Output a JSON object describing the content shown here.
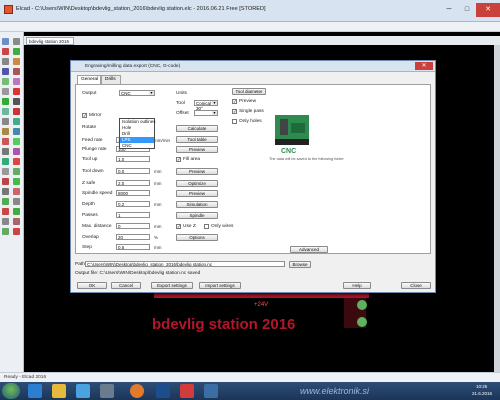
{
  "window": {
    "title": "Elcad - C:\\Users\\WIN\\Desktop\\bdevlig_station_2016\\bdevlig station.elc - 2016.06.21 Free [STORED]",
    "minimize": "─",
    "maximize": "□",
    "close": "✕"
  },
  "tab": {
    "label": "bdevlig station 2016"
  },
  "dialog": {
    "title": "Engraving/milling data export (CNC, G-code)",
    "close": "✕",
    "tabs": [
      "General",
      "Drills"
    ],
    "fields": {
      "output_label": "Output",
      "output_value": "CNC",
      "output_options": [
        "Isolation outlines",
        "Hole",
        "Drill",
        "LPS",
        "CNC"
      ],
      "units_label": "Units",
      "mirror_label": "Mirror",
      "rotate_label": "Rotate",
      "tool_label": "Tool",
      "tool_value": "Conical 30°",
      "offset_label": "Offset",
      "set_origin_label": "Set origin",
      "feedrate_label": "Feed rate",
      "feedrate_value": "100",
      "feedrate_unit": "mm/min",
      "plunge_label": "Plunge rate",
      "plunge_value": "100",
      "tool_up_label": "Tool up",
      "tool_up_value": "1.0",
      "tool_down_label": "Tool down",
      "tool_down_value": "0.0",
      "z_safe_label": "Z safe",
      "z_safe_value": "2.0",
      "speed_label": "Spindle speed",
      "speed_value": "8000",
      "depth_label": "Depth",
      "depth_value": "0.2",
      "passes_label": "Passes",
      "passes_value": "1",
      "max_dist_label": "Max. distance",
      "max_dist_value": "0",
      "overlap_label": "Overlap",
      "overlap_value": "20",
      "step_label": "Step",
      "step_value": "0.5",
      "mm": "mm",
      "percent": "%",
      "check_label": "Check",
      "fill_label": "Fill area",
      "only_wires_label": "Only wires",
      "use_z_label": "Use Z",
      "use_z_check": "Use Z",
      "recalc_label": "Recalculate"
    },
    "buttons": {
      "btn1": "Calculate",
      "btn2": "Tool table",
      "btn3": "Preview",
      "btn4": "Preview",
      "btn5": "Optimize",
      "btn6": "Preview",
      "btn7": "Simulation",
      "btn8": "Spindle",
      "btn9": "Options",
      "btn10": "Machine setup",
      "btn11": "Advanced"
    },
    "right": {
      "title": "Tool diameter",
      "opt1": "Preview",
      "opt2": "Single pass",
      "opt3": "Only holes",
      "caption": "CNC",
      "note": "The data will be saved to the following folder"
    },
    "path_label": "Path",
    "path_value": "C:\\Users\\WIN\\Desktop\\bdevlig_station_2016\\bdevlig station.nc",
    "browse": "Browse",
    "saved_note": "Output file: C:\\Users\\WIN\\Desktop\\bdevlig station.nc saved",
    "footer": {
      "ok": "OK",
      "cancel": "Cancel",
      "export": "Export settings",
      "import": "Import settings",
      "help": "Help",
      "close": "Close"
    }
  },
  "pcb": {
    "label_text": "bdevlig station 2016",
    "net_label": "+24V"
  },
  "status": {
    "text": "Ready - Elcad 2016"
  },
  "taskbar": {
    "url": "www.elektronik.si",
    "time": "10:25",
    "date": "21.6.2016"
  },
  "colors": {
    "titlebar": "#d7e3f1",
    "pcb_copper": "#b3152a",
    "pcb_pad": "#5fb05f",
    "selection": "#3399ff"
  }
}
